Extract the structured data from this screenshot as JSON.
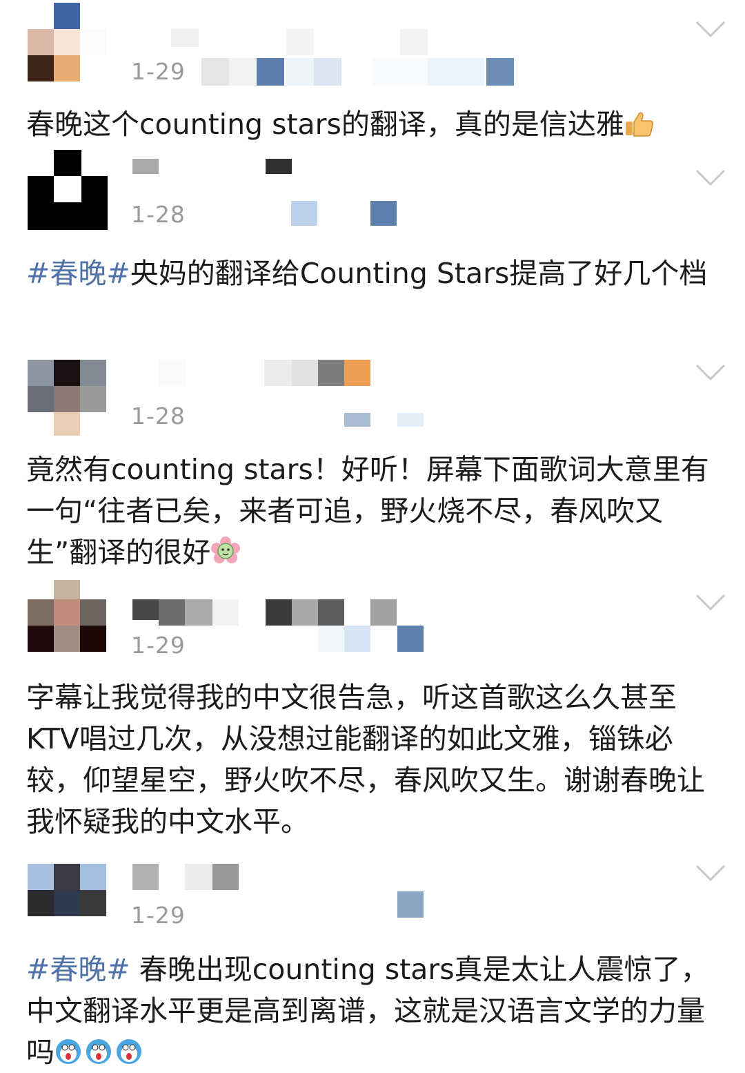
{
  "posts": [
    {
      "date": "1-29",
      "text": "春晚这个counting stars的翻译，真的是信达雅",
      "tag": "",
      "emoji": "thumbs-up-icon"
    },
    {
      "date": "1-28",
      "tag": "#春晚#",
      "text": "央妈的翻译给Counting Stars提高了好几个档",
      "emoji": ""
    },
    {
      "date": "1-28",
      "tag": "",
      "text": "竟然有counting stars！好听！屏幕下面歌词大意里有一句“往者已矣，来者可追，野火烧不尽，春风吹又生”翻译的很好",
      "emoji": "flower-face-icon"
    },
    {
      "date": "1-29",
      "tag": "",
      "text": "字幕让我觉得我的中文很告急，听这首歌这么久甚至KTV唱过几次，从没想过能翻译的如此文雅，锱铢必较，仰望星空，野火吹不尽，春风吹又生。谢谢春晚让我怀疑我的中文水平。",
      "emoji": ""
    },
    {
      "date": "1-29",
      "tag": "#春晚#",
      "text": " 春晚出现counting stars真是太让人震惊了，中文翻译水平更是高到离谱，这就是汉语言文学的力量吗",
      "emoji": "surprised-face-icon"
    }
  ],
  "colors": {
    "tag": "#4f72a8",
    "date": "#9a9a9a",
    "text": "#1c1c1c",
    "chevron": "#c8c8c8"
  }
}
